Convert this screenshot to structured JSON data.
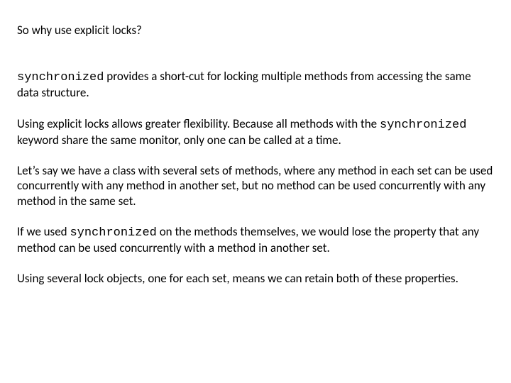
{
  "title": "So why use explicit locks?",
  "p1": {
    "code1": "synchronized",
    "text1": " provides a short-cut for locking multiple methods from accessing the same data structure."
  },
  "p2": {
    "text1": "Using explicit locks allows greater flexibility.  Because all methods with the ",
    "code1": "synchronized",
    "text2": " keyword share the same monitor, only one can be called at a time."
  },
  "p3": "Let’s say we have a class with several sets of methods, where any method in each set can be used concurrently with any method in another set, but no method can be used concurrently with any method in the same set.",
  "p4": {
    "text1": "If we used ",
    "code1": "synchronized",
    "text2": " on the methods themselves, we would lose the property that any method can be used concurrently with a method in another set."
  },
  "p5": "Using several lock objects, one for each set, means we can retain both of these properties."
}
